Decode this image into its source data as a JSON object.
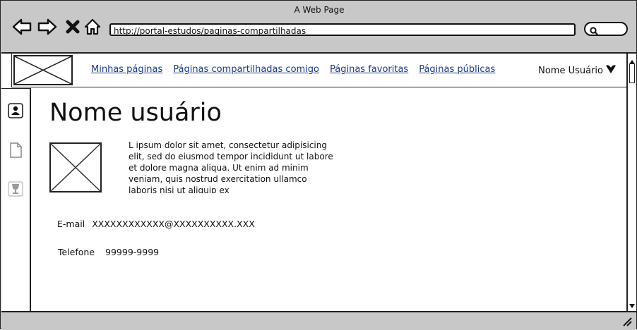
{
  "window": {
    "title": "A Web Page"
  },
  "browser": {
    "url": "http://portal-estudos/paginas-compartilhadas",
    "icons": [
      "back-arrow-icon",
      "forward-arrow-icon",
      "close-x-icon",
      "home-icon",
      "search-icon"
    ]
  },
  "nav": {
    "links": [
      "Minhas páginas",
      "Páginas compartilhadas comigo",
      "Páginas favoritas",
      "Páginas públicas"
    ],
    "user_name": "Nome Usuário"
  },
  "sidebar": {
    "icons": [
      "user-profile-icon",
      "document-icon",
      "trophy-icon"
    ]
  },
  "profile": {
    "title": "Nome usuário",
    "bio": "L ipsum dolor sit amet, consectetur adipisicing elit, sed do eiusmod tempor incididunt ut labore et dolore magna aliqua. Ut enim ad minim veniam, quis nostrud exercitation ullamco laboris nisi ut aliquip ex",
    "email_label": "E-mail",
    "email_value": "XXXXXXXXXXXX@XXXXXXXXXX.XXX",
    "phone_label": "Telefone",
    "phone_value": "99999-9999"
  },
  "colors": {
    "link": "#1a3a8a",
    "chrome": "#c8c8c8"
  }
}
